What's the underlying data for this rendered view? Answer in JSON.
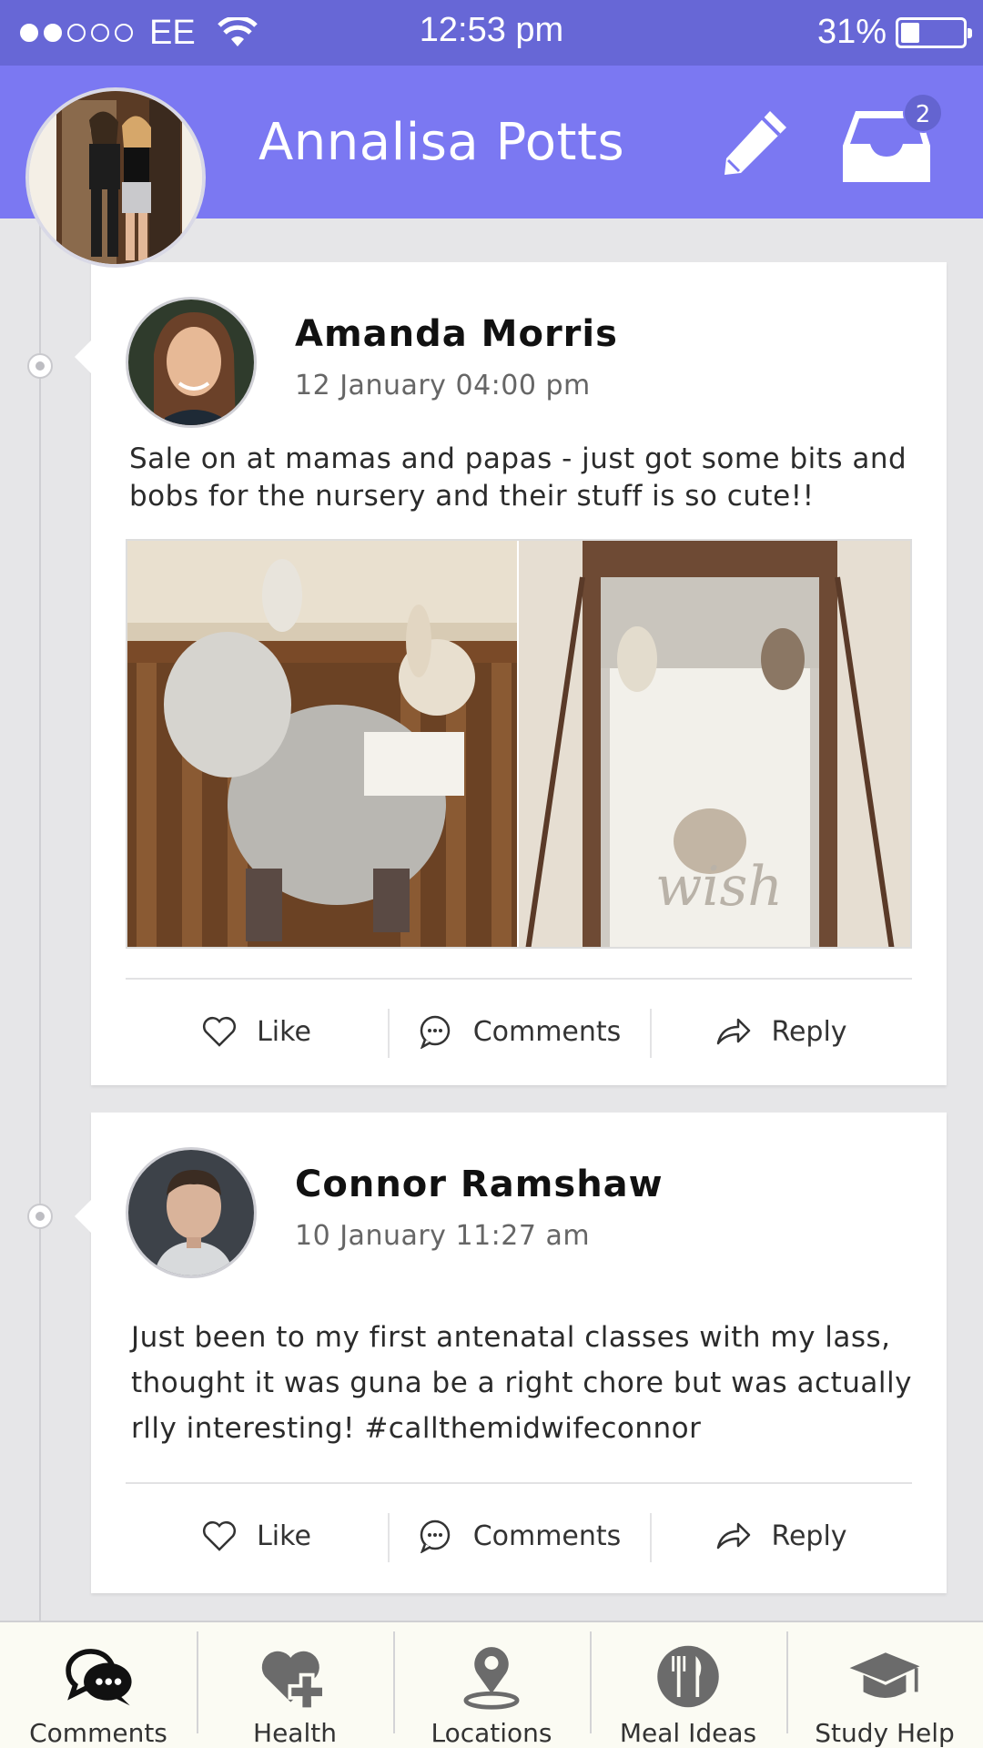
{
  "status_bar": {
    "carrier": "EE",
    "time": "12:53 pm",
    "battery": "31%",
    "battery_level": 0.31,
    "signal_bars": 2
  },
  "header": {
    "title": "Annalisa Potts",
    "edit_icon": "pencil-icon",
    "inbox_icon": "inbox-tray-icon",
    "inbox_badge": "2",
    "accent_color": "#7b78f2",
    "status_color": "#6767d6"
  },
  "posts": [
    {
      "author": "Amanda Morris",
      "date": "12 January 04:00 pm",
      "text": "Sale on at mamas and papas - just got some bits and bobs for the nursery and their stuff is so cute!!",
      "actions": {
        "like": "Like",
        "comments": "Comments",
        "reply": "Reply"
      }
    },
    {
      "author": "Connor Ramshaw",
      "date": "10 January 11:27 am",
      "text": "Just been to my first antenatal classes with my lass, thought it was guna be a right chore but was actually rlly interesting! #callthemidwifeconnor",
      "actions": {
        "like": "Like",
        "comments": "Comments",
        "reply": "Reply"
      }
    }
  ],
  "bottom_nav": [
    {
      "label": "Comments",
      "icon": "chat-bubbles-icon",
      "active": true
    },
    {
      "label": "Health",
      "icon": "heart-plus-icon",
      "active": false
    },
    {
      "label": "Locations",
      "icon": "map-pin-icon",
      "active": false
    },
    {
      "label": "Meal Ideas",
      "icon": "fork-knife-icon",
      "active": false
    },
    {
      "label": "Study Help",
      "icon": "graduation-cap-icon",
      "active": false
    }
  ]
}
